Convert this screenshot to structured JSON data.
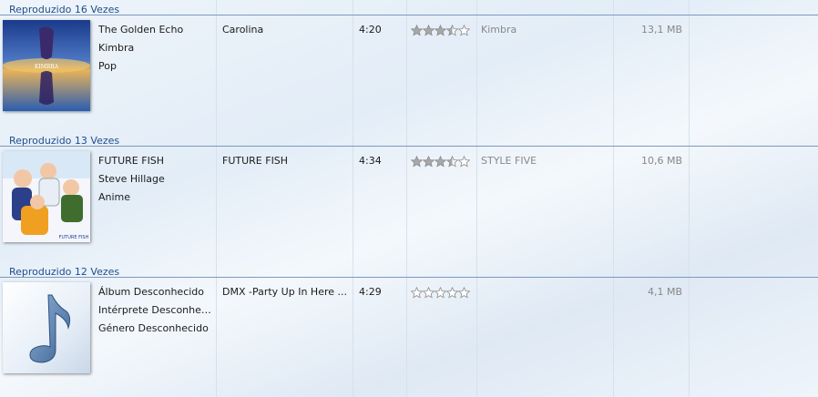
{
  "colors": {
    "header_text": "#1f4e8c",
    "rule": "#7b99bf",
    "star_fill": "#a8a8a8",
    "star_stroke": "#8c8c8c"
  },
  "groups": [
    {
      "header": "Reproduzido 16 Vezes",
      "album": "The Golden Echo",
      "artist": "Kimbra",
      "genre": "Pop",
      "title": "Carolina",
      "length": "4:20",
      "rating": 3.5,
      "composer": "Kimbra",
      "size": "13,1 MB",
      "art": "album-cover-art",
      "art_text": "KIMBRA"
    },
    {
      "header": "Reproduzido 13 Vezes",
      "album": "FUTURE FISH",
      "artist": "Steve Hillage",
      "genre": "Anime",
      "title": "FUTURE FISH",
      "length": "4:34",
      "rating": 3.5,
      "composer": "STYLE FIVE",
      "size": "10,6 MB",
      "art": "anime-cover-art",
      "art_text": "FUTURE FISH"
    },
    {
      "header": "Reproduzido 12 Vezes",
      "album": "Álbum Desconhecido",
      "artist": "Intérprete Desconhecido",
      "genre": "Género Desconhecido",
      "title": "DMX -Party Up In Here ...",
      "length": "4:29",
      "rating": 0,
      "composer": "",
      "size": "4,1 MB",
      "art": "music-note-icon"
    }
  ]
}
